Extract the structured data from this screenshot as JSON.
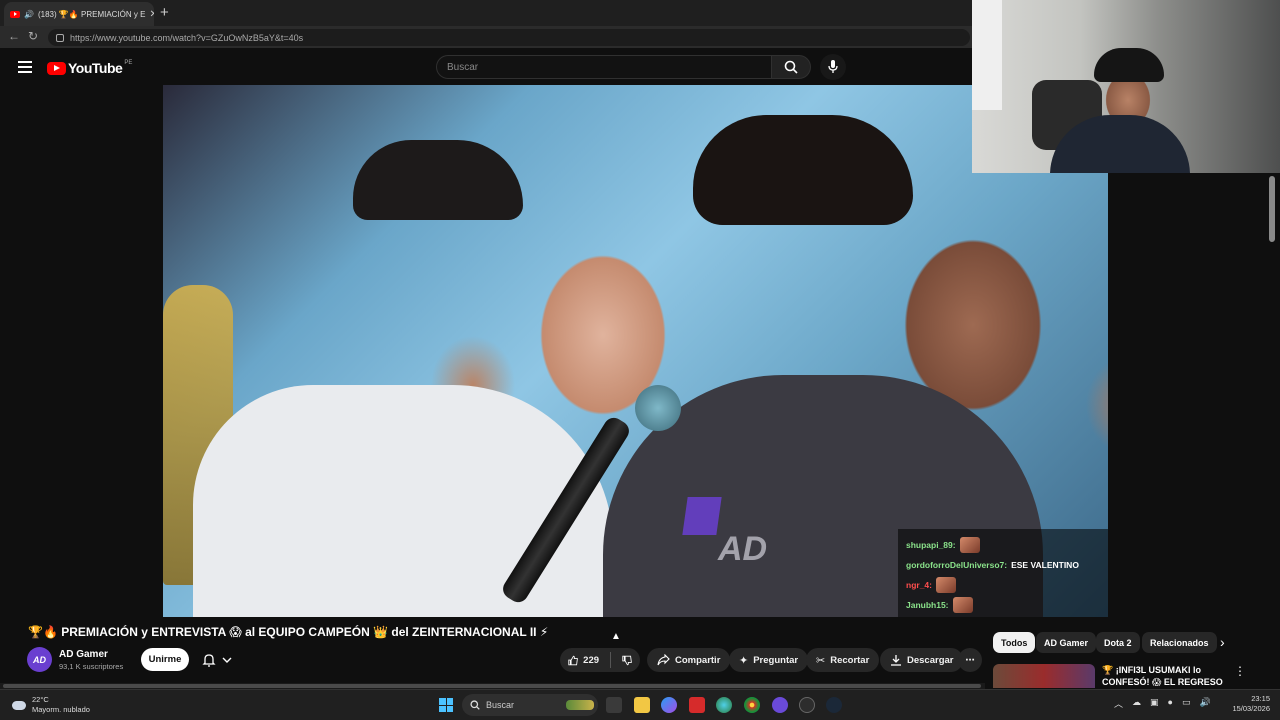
{
  "browser": {
    "tab_title": "(183) 🏆🔥 PREMIACIÓN y E",
    "tab_close": "✕",
    "new_tab": "+",
    "url": "https://www.youtube.com/watch?v=GZuOwNzB5aY&t=40s"
  },
  "youtube": {
    "logo_text": "YouTube",
    "country_code": "PE",
    "search_placeholder": "Buscar"
  },
  "video": {
    "watermark": "AD",
    "corner_logo": "AD",
    "chat": [
      {
        "name": "shupapi_89:",
        "message": "",
        "color": "#8be38b",
        "emote": true
      },
      {
        "name": "gordoforroDelUniverso7:",
        "message": "ESE VALENTINO",
        "color": "#8be38b",
        "emote": false
      },
      {
        "name": "ngr_4:",
        "message": "",
        "color": "#ff4d4d",
        "emote": true
      },
      {
        "name": "Janubh15:",
        "message": "",
        "color": "#8be38b",
        "emote": true
      }
    ]
  },
  "details": {
    "title": "🏆🔥 PREMIACIÓN y ENTREVISTA 😱 al EQUIPO CAMPEÓN 👑 del ZEINTERNACIONAL II ⚡",
    "channel_name": "AD Gamer",
    "channel_avatar_text": "AD",
    "subscribers": "93,1 K suscriptores",
    "join_label": "Unirme",
    "likes": "229",
    "share_label": "Compartir",
    "ask_label": "Preguntar",
    "clip_label": "Recortar",
    "download_label": "Descargar",
    "more_label": "⋯"
  },
  "chips": [
    "Todos",
    "AD Gamer",
    "Dota 2",
    "Relacionados"
  ],
  "recommended": {
    "title": "🏆 ¡INFI3L USUMAKI lo CONFESÓ! 😱 EL REGRESO de...",
    "more": "⋮"
  },
  "taskbar": {
    "temperature": "22°C",
    "weather": "Mayorm. nublado",
    "search": "Buscar",
    "time": "23:15",
    "date": "15/03/2026"
  }
}
